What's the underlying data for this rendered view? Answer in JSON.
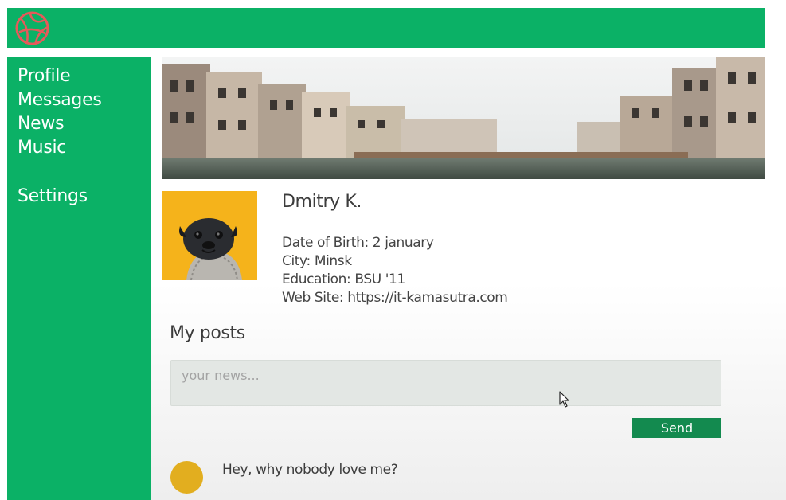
{
  "nav": {
    "items": [
      {
        "label": "Profile"
      },
      {
        "label": "Messages"
      },
      {
        "label": "News"
      },
      {
        "label": "Music"
      },
      {
        "label": "Settings"
      }
    ]
  },
  "header": {
    "logo_icon": "basketball-logo-icon"
  },
  "colors": {
    "brand": "#0bb166",
    "button": "#138a4f",
    "avatar_bg": "#f5b31b"
  },
  "profile": {
    "banner_icon": "city-canal-banner-image",
    "avatar_icon": "pug-avatar-image",
    "name": "Dmitry K.",
    "info": [
      "Date of Birth: 2 january",
      "City: Minsk",
      "Education: BSU '11",
      "Web Site: https://it-kamasutra.com"
    ]
  },
  "posts": {
    "title": "My posts",
    "placeholder": "your news...",
    "send_label": "Send",
    "items": [
      {
        "text": "Hey, why nobody love me?"
      }
    ]
  }
}
